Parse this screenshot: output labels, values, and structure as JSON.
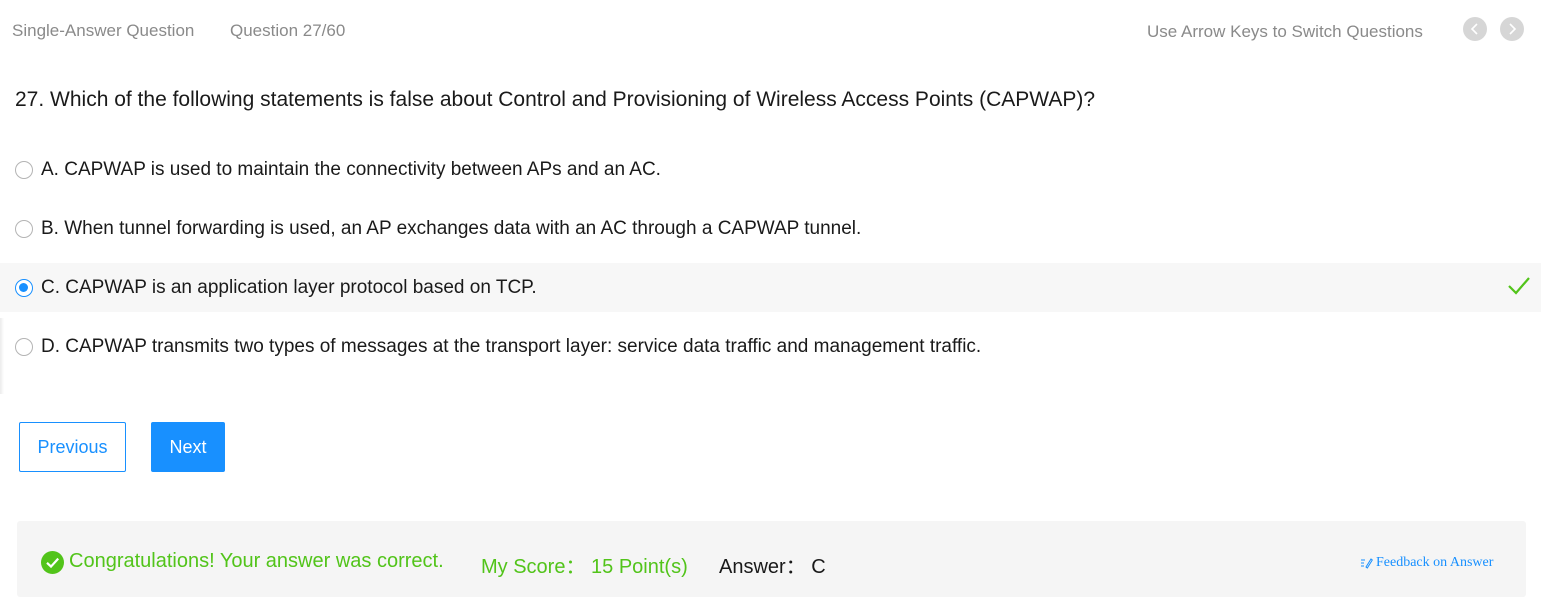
{
  "header": {
    "question_type": "Single-Answer Question",
    "question_counter": "Question 27/60",
    "arrow_hint": "Use Arrow Keys to Switch Questions",
    "prev_icon": "chevron-left-icon",
    "next_icon": "chevron-right-icon"
  },
  "question": {
    "text": "27. Which of the following statements is false about Control and Provisioning of Wireless Access Points (CAPWAP)?"
  },
  "options": [
    {
      "label": "A. CAPWAP is used to maintain the connectivity between APs and an AC.",
      "selected": false
    },
    {
      "label": "B. When tunnel forwarding is used, an AP exchanges data with an AC through a CAPWAP tunnel.",
      "selected": false
    },
    {
      "label": "C. CAPWAP is an application layer protocol based on TCP.",
      "selected": true,
      "correct_mark_icon": "check-icon"
    },
    {
      "label": "D. CAPWAP transmits two types of messages at the transport layer: service data traffic and management traffic.",
      "selected": false
    }
  ],
  "buttons": {
    "previous": "Previous",
    "next": "Next"
  },
  "result": {
    "congrats": "Congratulations! Your answer was correct.",
    "score": "My Score： 15 Point(s)",
    "answer": "Answer： C",
    "feedback": "Feedback on Answer",
    "success_icon": "check-circle-icon",
    "feedback_icon": "edit-icon"
  },
  "colors": {
    "accent": "#1890ff",
    "success": "#52c41a",
    "muted_text": "#8a8a8a",
    "panel_bg": "#f5f5f5"
  }
}
